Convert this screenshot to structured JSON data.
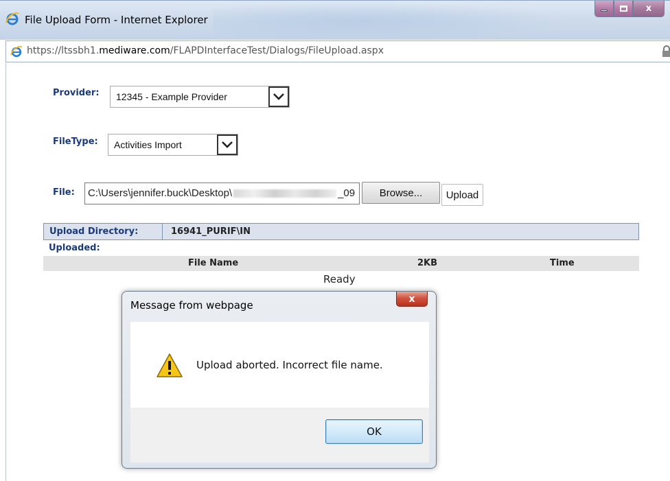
{
  "window": {
    "title": "File Upload Form - Internet Explorer",
    "address_url_prefix": "https://ltssbh1.",
    "address_host": "mediware.com",
    "address_path": "/FLAPDInterfaceTest/Dialogs/FileUpload.aspx",
    "close_label": "x"
  },
  "form": {
    "provider_label": "Provider:",
    "provider_value": "12345 - Example Provider",
    "filetype_label": "FileType:",
    "filetype_value": "Activities Import",
    "file_label": "File:",
    "file_path_start": "C:\\Users\\jennifer.buck\\Desktop\\",
    "file_path_end": "_09",
    "browse_label": "Browse...",
    "upload_label": "Upload"
  },
  "upload_info": {
    "directory_label": "Upload Directory:",
    "directory_value": "16941_PURIF\\IN",
    "uploaded_label": "Uploaded:",
    "columns": [
      "File Name",
      "2KB",
      "Time"
    ],
    "status": "Ready"
  },
  "dialog": {
    "title": "Message from webpage",
    "message": "Upload aborted. Incorrect file name.",
    "ok_label": "OK",
    "close_label": "x",
    "icon": "warning-icon"
  }
}
